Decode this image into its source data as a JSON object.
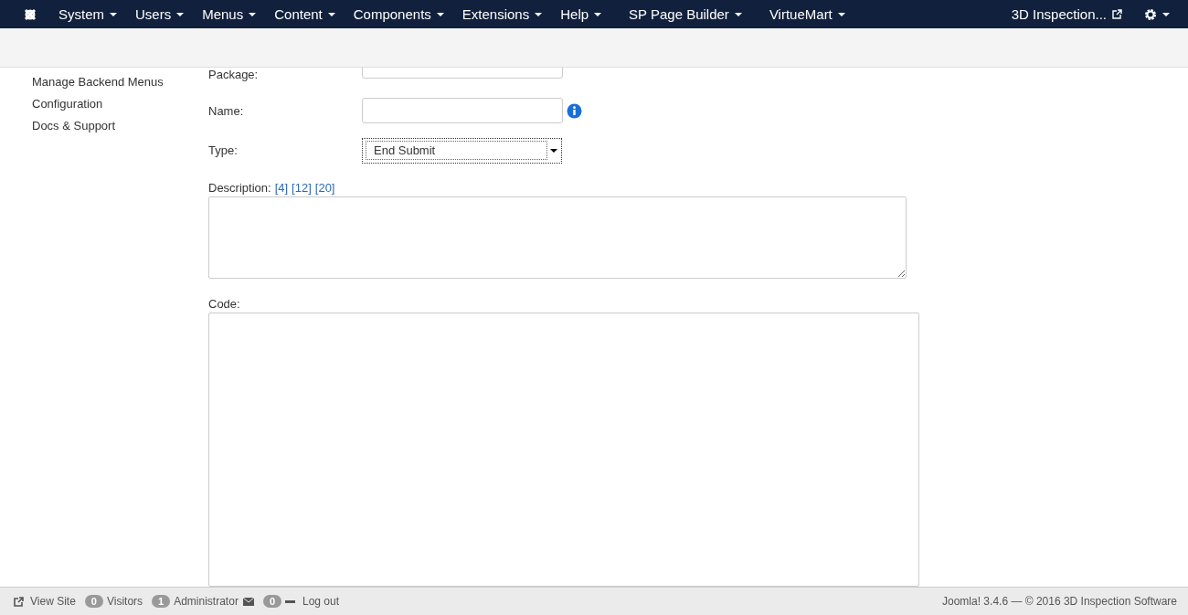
{
  "navbar": {
    "menus": [
      {
        "label": "System"
      },
      {
        "label": "Users"
      },
      {
        "label": "Menus"
      },
      {
        "label": "Content"
      },
      {
        "label": "Components"
      },
      {
        "label": "Extensions"
      },
      {
        "label": "Help"
      },
      {
        "label": "SP Page Builder"
      },
      {
        "label": "VirtueMart"
      }
    ],
    "site_link": "3D Inspection..."
  },
  "sidebar": {
    "items": [
      "Manage Backend Menus",
      "Configuration",
      "Docs & Support"
    ]
  },
  "form": {
    "package": {
      "label": "Package:"
    },
    "name": {
      "label": "Name:"
    },
    "type": {
      "label": "Type:",
      "value": "End Submit"
    },
    "description": {
      "label": "Description:",
      "links": [
        "[4]",
        "[12]",
        "[20]"
      ]
    },
    "code": {
      "label": "Code:"
    }
  },
  "status_bar": {
    "view_site": "View Site",
    "visitors_count": "0",
    "visitors": "Visitors",
    "admin_count": "1",
    "admin": "Administrator",
    "messages_count": "0",
    "logout": "Log out",
    "copyright": "Joomla! 3.4.6 — © 2016 3D Inspection Software"
  }
}
